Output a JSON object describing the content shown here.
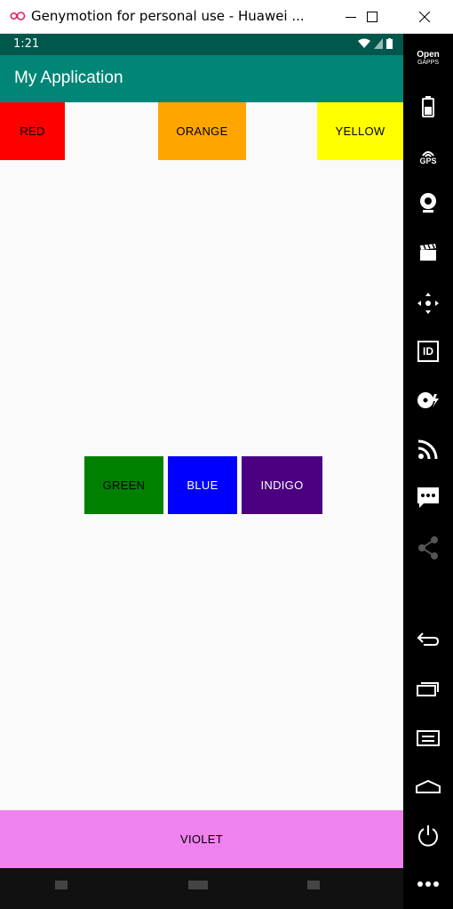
{
  "window": {
    "title": "Genymotion for personal use - Huawei ..."
  },
  "status_bar": {
    "time": "1:21"
  },
  "app": {
    "title": "My Application"
  },
  "buttons": {
    "red": "RED",
    "orange": "ORANGE",
    "yellow": "YELLOW",
    "green": "GREEN",
    "blue": "BLUE",
    "indigo": "INDIGO",
    "violet": "VIOLET"
  },
  "colors": {
    "red": "#ff0000",
    "orange": "#ffa500",
    "yellow": "#ffff00",
    "green": "#008000",
    "blue": "#0000ff",
    "indigo": "#4b0082",
    "violet": "#ee82ee",
    "app_bar": "#008577",
    "status_bar": "#00574b"
  },
  "sidebar": {
    "open_gapps_line1": "Open",
    "open_gapps_line2": "GAPPS",
    "gps_label": "GPS",
    "id_label": "ID"
  }
}
